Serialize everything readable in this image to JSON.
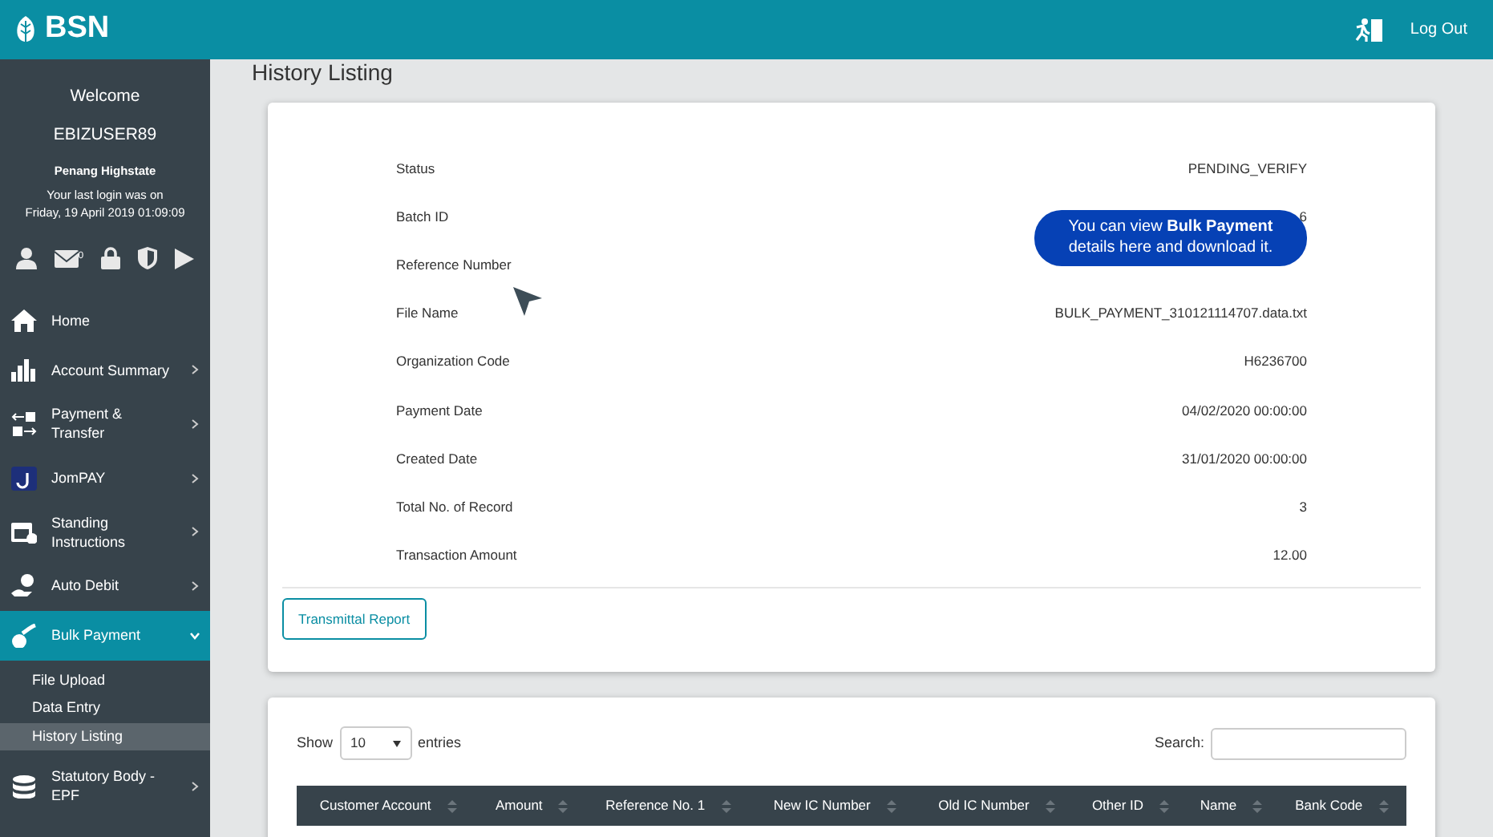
{
  "header": {
    "brand": "BSN",
    "logout": "Log Out"
  },
  "user": {
    "welcome": "Welcome",
    "username": "EBIZUSER89",
    "org": "Penang Highstate",
    "last_login_label": "Your last login was on",
    "last_login": "Friday, 19 April 2019 01:09:09",
    "mail_count": "0"
  },
  "sidebar": {
    "items": [
      {
        "label": "Home",
        "has_arrow": false,
        "selected": false
      },
      {
        "label": "Account Summary",
        "has_arrow": true,
        "expanded": false,
        "selected": false
      },
      {
        "label": "Payment & Transfer",
        "has_arrow": true,
        "expanded": false,
        "selected": false
      },
      {
        "label": "JomPAY",
        "has_arrow": true,
        "expanded": false,
        "selected": false
      },
      {
        "label": "Standing Instructions",
        "has_arrow": true,
        "expanded": false,
        "selected": false
      },
      {
        "label": "Auto Debit",
        "has_arrow": true,
        "expanded": false,
        "selected": false
      },
      {
        "label": "Bulk Payment",
        "has_arrow": true,
        "expanded": true,
        "selected": true,
        "children": [
          {
            "label": "File Upload",
            "selected": false
          },
          {
            "label": "Data Entry",
            "selected": false
          },
          {
            "label": "History Listing",
            "selected": true
          }
        ]
      },
      {
        "label": "Statutory Body - EPF",
        "has_arrow": true,
        "expanded": false,
        "selected": false
      }
    ]
  },
  "page_title": "History Listing",
  "details": [
    {
      "label": "Status",
      "value": "PENDING_VERIFY"
    },
    {
      "label": "Batch ID",
      "value": "6"
    },
    {
      "label": "Reference Number"
    },
    {
      "label": "File Name",
      "value": "BULK_PAYMENT_310121114707.data.txt"
    },
    {
      "label": "Organization Code",
      "value": "H6236700"
    },
    {
      "label": "Payment Date",
      "value": "04/02/2020 00:00:00"
    },
    {
      "label": "Created Date",
      "value": "31/01/2020 00:00:00"
    },
    {
      "label": "Total No. of Record",
      "value": "3"
    },
    {
      "label": "Transaction Amount",
      "value": "12.00"
    }
  ],
  "report_button": "Transmittal Report",
  "tooltip": "You can view **Bulk Payment** details here and download it.",
  "table": {
    "show_label": "Show",
    "entries_value": "10",
    "entries_label": "entries",
    "search_label": "Search:",
    "columns": [
      "Customer Account",
      "Amount",
      "Reference No. 1",
      "New IC Number",
      "Old IC Number",
      "Other ID",
      "Name",
      "Bank Code"
    ]
  }
}
